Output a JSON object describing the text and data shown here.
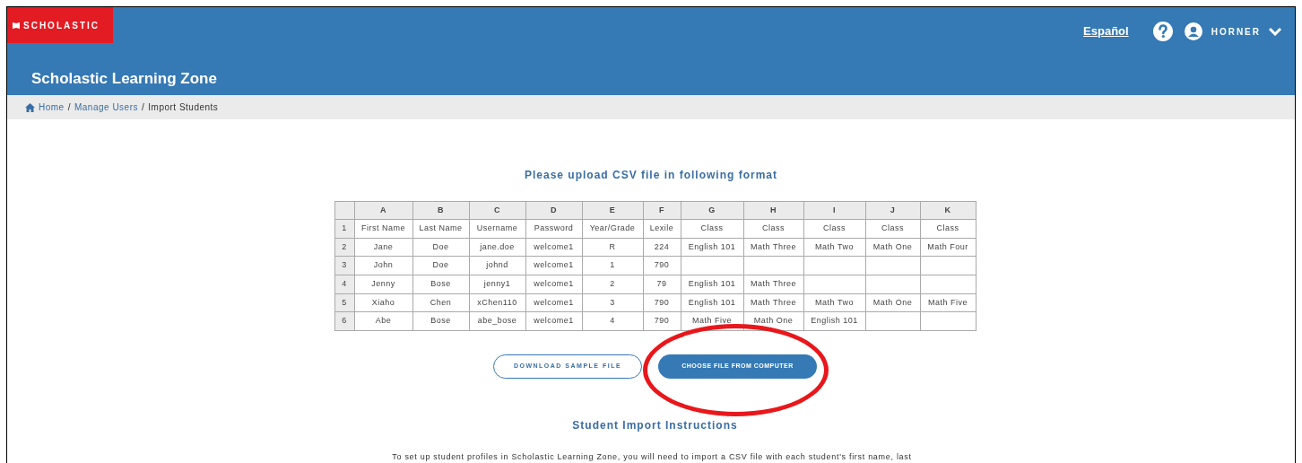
{
  "header": {
    "logo": "SCHOLASTIC",
    "app_title": "Scholastic Learning Zone",
    "language_link": "Español",
    "user_name": "HORNER"
  },
  "breadcrumb": [
    {
      "label": "Home",
      "link": true
    },
    {
      "label": "Manage Users",
      "link": true,
      "separator": "/"
    },
    {
      "label": "Import Students",
      "link": false,
      "separator": "/"
    }
  ],
  "upload_heading": "Please upload CSV file in following format",
  "table": {
    "columns": [
      "A",
      "B",
      "C",
      "D",
      "E",
      "F",
      "G",
      "H",
      "I",
      "J",
      "K"
    ],
    "rows": [
      {
        "number": "1",
        "cells": [
          "First Name",
          "Last Name",
          "Username",
          "Password",
          "Year/Grade",
          "Lexile",
          "Class",
          "Class",
          "Class",
          "Class",
          "Class"
        ]
      },
      {
        "number": "2",
        "cells": [
          "Jane",
          "Doe",
          "jane.doe",
          "welcome1",
          "R",
          "224",
          "English 101",
          "Math Three",
          "Math Two",
          "Math One",
          "Math Four"
        ]
      },
      {
        "number": "3",
        "cells": [
          "John",
          "Doe",
          "johnd",
          "welcome1",
          "1",
          "790",
          "",
          "",
          "",
          "",
          ""
        ]
      },
      {
        "number": "4",
        "cells": [
          "Jenny",
          "Bose",
          "jenny1",
          "welcome1",
          "2",
          "79",
          "English 101",
          "Math Three",
          "",
          "",
          ""
        ]
      },
      {
        "number": "5",
        "cells": [
          "Xiaho",
          "Chen",
          "xChen110",
          "welcome1",
          "3",
          "790",
          "English 101",
          "Math Three",
          "Math Two",
          "Math One",
          "Math Five"
        ]
      },
      {
        "number": "6",
        "cells": [
          "Abe",
          "Bose",
          "abe_bose",
          "welcome1",
          "4",
          "790",
          "Math Five",
          "Math One",
          "English 101",
          "",
          ""
        ]
      }
    ]
  },
  "buttons": [
    {
      "label": "DOWNLOAD SAMPLE FILE",
      "kind": "outline",
      "circled": false
    },
    {
      "label": "CHOOSE FILE FROM COMPUTER",
      "kind": "filled",
      "circled": true
    }
  ],
  "instructions": {
    "heading": "Student Import Instructions",
    "text": "To set up student profiles in Scholastic Learning Zone, you will need to import a CSV file with each student's first name, last"
  }
}
